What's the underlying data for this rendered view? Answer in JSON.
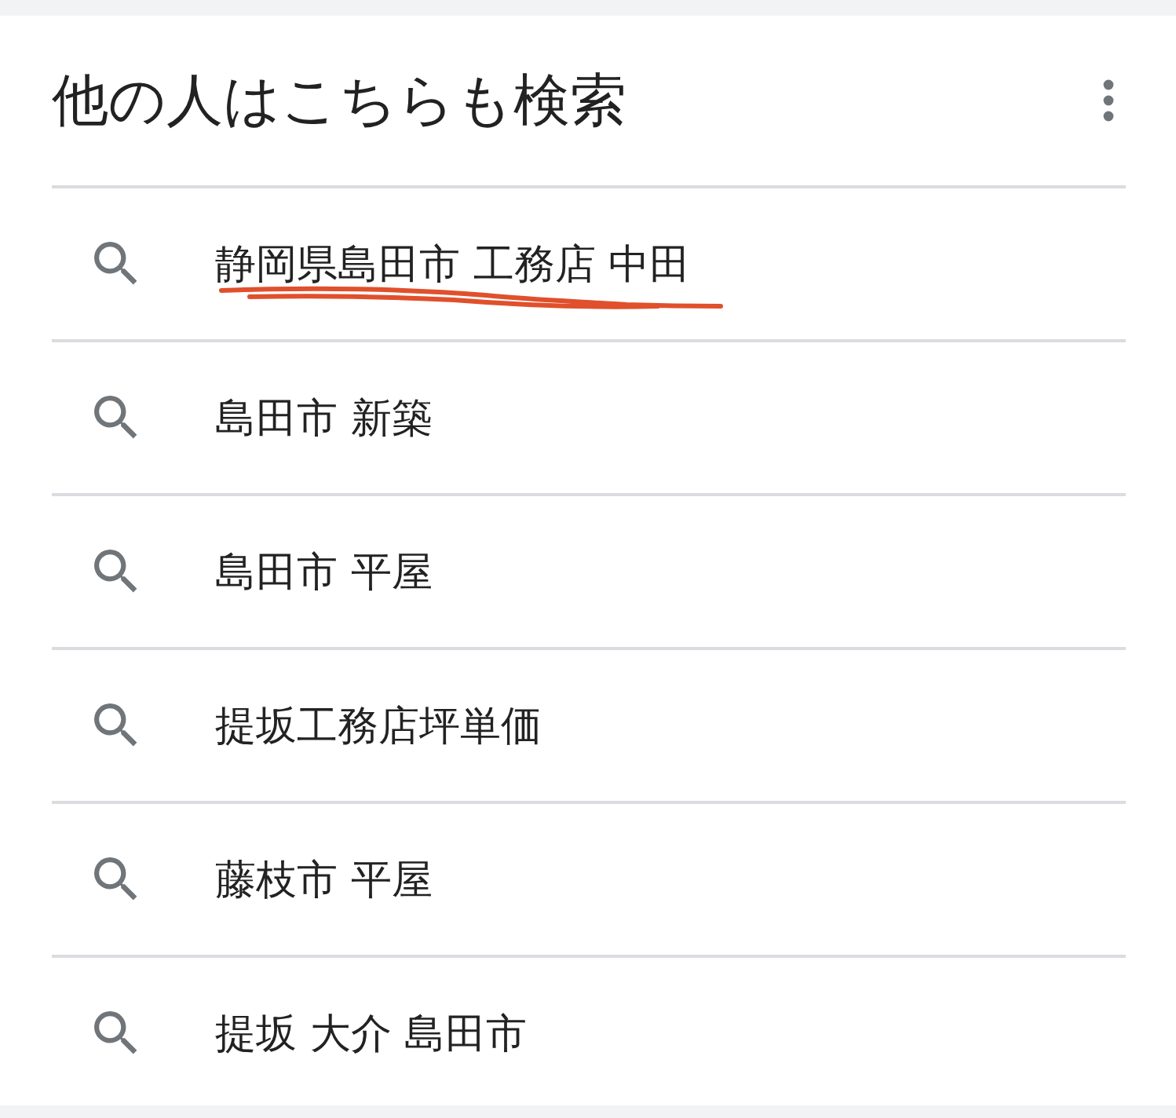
{
  "card": {
    "title": "他の人はこちらも検索"
  },
  "suggestions": [
    {
      "text": "静岡県島田市 工務店 中田",
      "underlined": true
    },
    {
      "text": "島田市 新築",
      "underlined": false
    },
    {
      "text": "島田市 平屋",
      "underlined": false
    },
    {
      "text": "提坂工務店坪単価",
      "underlined": false
    },
    {
      "text": "藤枝市 平屋",
      "underlined": false
    },
    {
      "text": "提坂 大介 島田市",
      "underlined": false
    }
  ]
}
